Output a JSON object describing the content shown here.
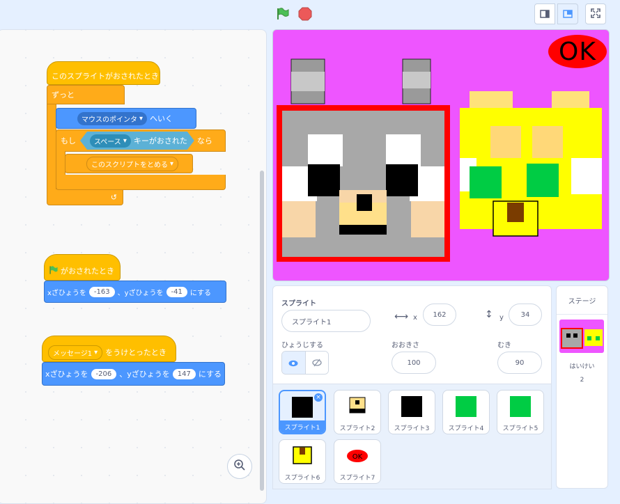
{
  "topbar": {
    "green_flag_icon": "green-flag-icon",
    "stop_icon": "stop-icon",
    "small_stage_icon": "small-stage-icon",
    "normal_stage_icon": "normal-stage-icon",
    "fullscreen_icon": "fullscreen-icon"
  },
  "scripts": {
    "script1": {
      "hat": "このスプライトがおされたとき",
      "forever": "ずっと",
      "goto_prefix": "マウスのポインタ",
      "goto_suffix": "へいく",
      "if_label": "もし",
      "key_menu": "スペース",
      "key_pressed": "キーがおされた",
      "then": "なら",
      "stop_menu": "このスクリプトをとめる",
      "loop_arrow": "↺"
    },
    "script2": {
      "hat": "がおされたとき",
      "x_label": "xざひょうを",
      "x_value": "-163",
      "y_label": "、yざひょうを",
      "y_value": "-41",
      "suffix": "にする"
    },
    "script3": {
      "message_menu": "メッセージ1",
      "hat_suffix": "をうけとったとき",
      "x_label": "xざひょうを",
      "x_value": "-206",
      "y_label": "、yざひょうを",
      "y_value": "147",
      "suffix": "にする"
    }
  },
  "stage": {
    "background": "#ee55ff",
    "ok_text": "OK"
  },
  "sprite_info": {
    "sprite_label": "スプライト",
    "sprite_name": "スプライト1",
    "x_label": "x",
    "x_value": "162",
    "y_label": "y",
    "y_value": "34",
    "show_label": "ひょうじする",
    "size_label": "おおきさ",
    "size_value": "100",
    "direction_label": "むき",
    "direction_value": "90"
  },
  "sprites": [
    {
      "name": "スプライト1",
      "selected": true
    },
    {
      "name": "スプライト2",
      "selected": false
    },
    {
      "name": "スプライト3",
      "selected": false
    },
    {
      "name": "スプライト4",
      "selected": false
    },
    {
      "name": "スプライト5",
      "selected": false
    },
    {
      "name": "スプライト6",
      "selected": false
    },
    {
      "name": "スプライト7",
      "selected": false
    }
  ],
  "stage_panel": {
    "title": "ステージ",
    "backdrops_label": "はいけい",
    "backdrops_count": "2"
  },
  "colors": {
    "events": "#ffbf00",
    "control": "#ffab19",
    "motion": "#4c97ff",
    "sensing": "#5cb1d6",
    "accent": "#4c97ff"
  }
}
